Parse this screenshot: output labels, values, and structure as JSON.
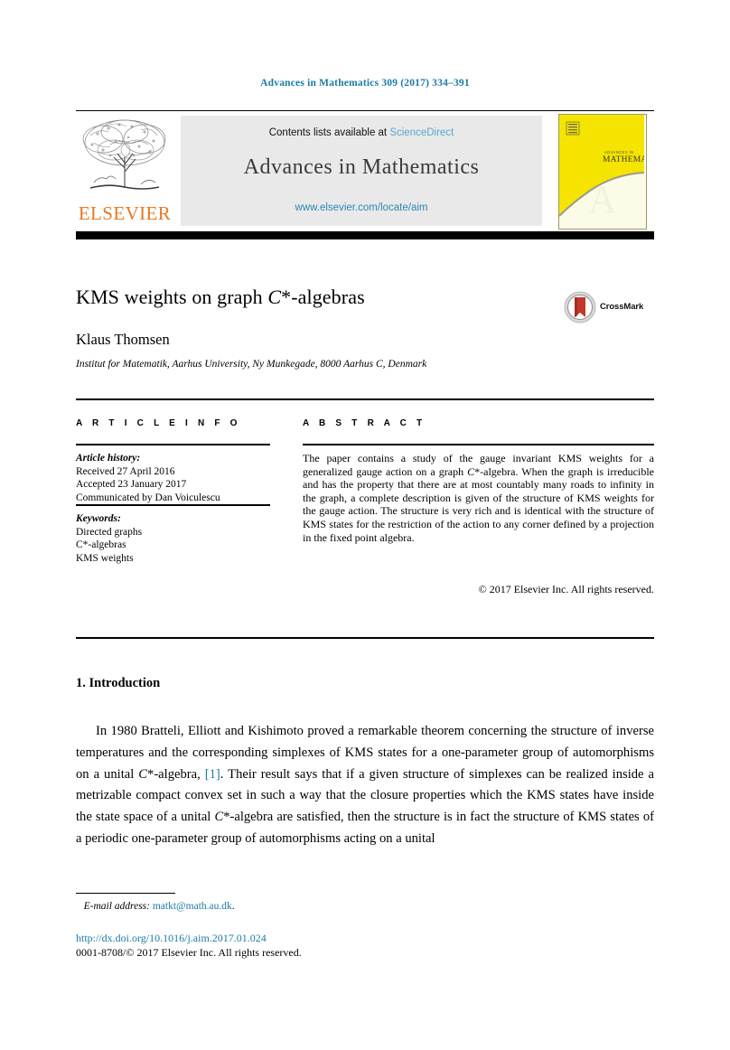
{
  "running_head": "Advances in Mathematics 309 (2017) 334–391",
  "masthead": {
    "contents_prefix": "Contents lists available at ",
    "sciencedirect": "ScienceDirect",
    "journal_name": "Advances in Mathematics",
    "journal_url": "www.elsevier.com/locate/aim",
    "publisher": "ELSEVIER",
    "cover_title_small": "ADVANCES IN",
    "cover_title": "MATHEMATICS"
  },
  "article": {
    "title_pre": "KMS weights on graph ",
    "title_italic": "C",
    "title_post": "*-algebras",
    "crossmark_label": "CrossMark",
    "author": "Klaus Thomsen",
    "affiliation": "Institut for Matematik, Aarhus University, Ny Munkegade, 8000 Aarhus C, Denmark"
  },
  "info": {
    "heading": "A R T I C L E   I N F O",
    "history_label": "Article history:",
    "received": "Received 27 April 2016",
    "accepted": "Accepted 23 January 2017",
    "communicated": "Communicated by Dan Voiculescu",
    "keywords_label": "Keywords:",
    "keywords": [
      "Directed graphs",
      "C*-algebras",
      "KMS weights"
    ]
  },
  "abstract": {
    "heading": "A B S T R A C T",
    "part1": "The paper contains a study of the gauge invariant KMS weights for a generalized gauge action on a graph ",
    "italic1": "C",
    "part2": "*-algebra. When the graph is irreducible and has the property that there are at most countably many roads to infinity in the graph, a complete description is given of the structure of KMS weights for the gauge action. The structure is very rich and is identical with the structure of KMS states for the restriction of the action to any corner defined by a projection in the fixed point algebra.",
    "copyright": "© 2017 Elsevier Inc. All rights reserved."
  },
  "body": {
    "section_title": "1. Introduction",
    "para1_a": "In 1980 Bratteli, Elliott and Kishimoto proved a remarkable theorem concerning the structure of inverse temperatures and the corresponding simplexes of KMS states for a one-parameter group of automorphisms on a unital ",
    "para1_italic1": "C",
    "para1_b": "*-algebra, ",
    "para1_ref": "[1]",
    "para1_c": ". Their result says that if a given structure of simplexes can be realized inside a metrizable compact convex set in such a way that the closure properties which the KMS states have inside the state space of a unital ",
    "para1_italic2": "C",
    "para1_d": "*-algebra are satisfied, then the structure is in fact the structure of KMS states of a periodic one-parameter group of automorphisms acting on a unital"
  },
  "footer": {
    "email_label": "E-mail address:",
    "email": "matkt@math.au.dk",
    "email_trailing": ".",
    "doi": "http://dx.doi.org/10.1016/j.aim.2017.01.024",
    "issn": "0001-8708/© 2017 Elsevier Inc. All rights reserved."
  },
  "colors": {
    "link_blue": "#1b7aa3",
    "sciencedirect_blue": "#56a8cf",
    "elsevier_orange": "#E87722",
    "cover_yellow": "#F5E400"
  }
}
